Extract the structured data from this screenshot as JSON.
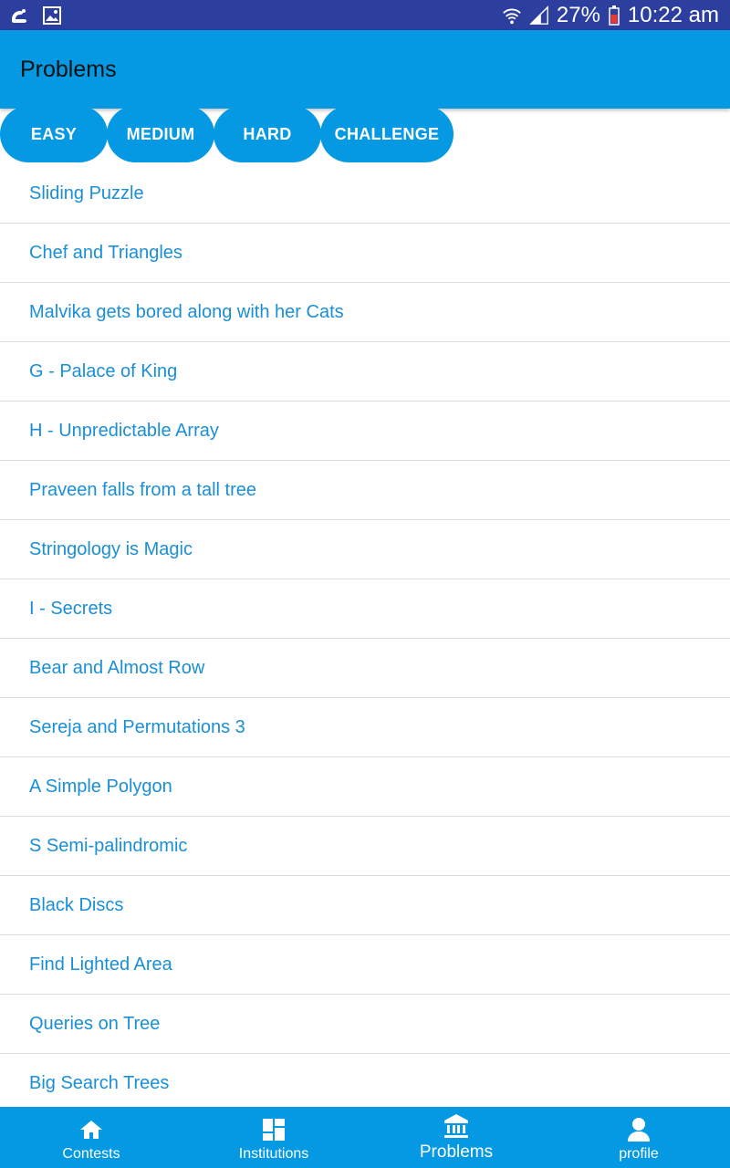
{
  "status_bar": {
    "battery": "27%",
    "time": "10:22 am",
    "icons": [
      "uc-browser-icon",
      "image-icon",
      "wifi-icon",
      "signal-icon",
      "battery-icon"
    ]
  },
  "app_bar": {
    "title": "Problems"
  },
  "filters": [
    {
      "label": "EASY"
    },
    {
      "label": "MEDIUM"
    },
    {
      "label": "HARD"
    },
    {
      "label": "CHALLENGE"
    }
  ],
  "problems": [
    "Sliding Puzzle",
    "Chef and Triangles",
    "Malvika gets bored along with her Cats",
    "G - Palace of King",
    "H - Unpredictable Array",
    "Praveen falls from a tall tree",
    "Stringology is Magic",
    "I - Secrets",
    "Bear and Almost Row",
    "Sereja and Permutations 3",
    "A Simple Polygon",
    "S Semi-palindromic",
    "Black Discs",
    "Find Lighted Area",
    "Queries on Tree",
    "Big Search Trees"
  ],
  "bottom_nav": [
    {
      "label": "Contests",
      "icon": "home-icon"
    },
    {
      "label": "Institutions",
      "icon": "dashboard-icon"
    },
    {
      "label": "Problems",
      "icon": "institution-icon",
      "active": true
    },
    {
      "label": "profile",
      "icon": "person-icon"
    }
  ],
  "colors": {
    "status_bar": "#2c3e9e",
    "primary": "#0499e2",
    "link_text": "#1a8fd6",
    "divider": "#dcdcdc"
  }
}
